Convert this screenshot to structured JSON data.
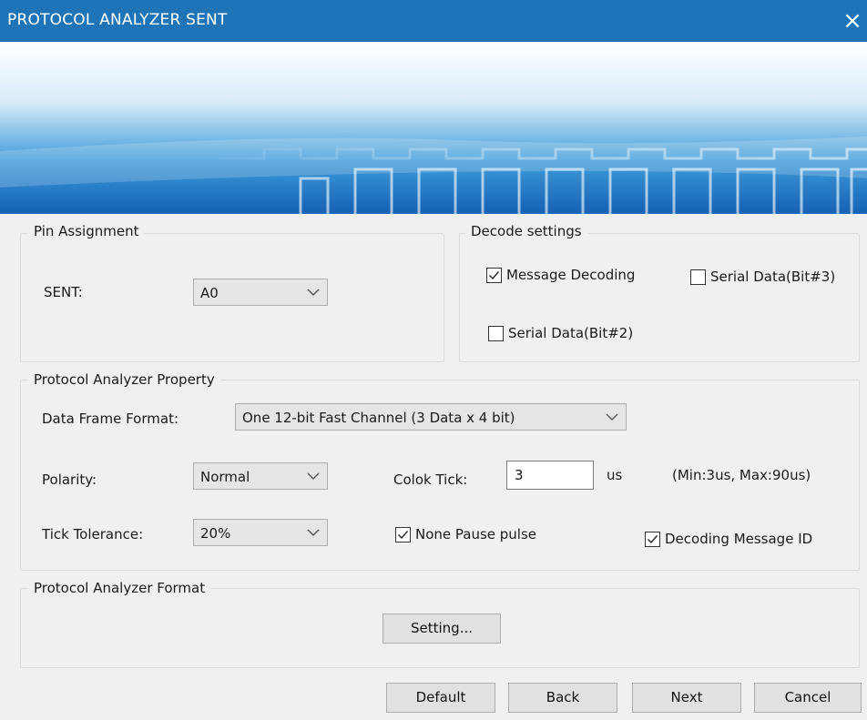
{
  "window": {
    "title": "PROTOCOL ANALYZER SENT",
    "close_glyph": "×",
    "titlebar_color": "#1e74b6"
  },
  "pin_assignment": {
    "title": "Pin Assignment",
    "sent_label": "SENT:",
    "sent_value": "A0"
  },
  "decode_settings": {
    "title": "Decode settings",
    "message_decoding": {
      "label": "Message Decoding",
      "checked": true
    },
    "serial_bit3": {
      "label": "Serial Data(Bit#3)",
      "checked": false
    },
    "serial_bit2": {
      "label": "Serial Data(Bit#2)",
      "checked": false
    }
  },
  "property": {
    "title": "Protocol Analyzer Property",
    "frame_format_label": "Data Frame Format:",
    "frame_format_value": "One 12-bit Fast Channel (3 Data x 4 bit)",
    "polarity_label": "Polarity:",
    "polarity_value": "Normal",
    "clock_tick_label": "Colok Tick:",
    "clock_tick_value": "3",
    "clock_tick_unit": "us",
    "clock_tick_range": "(Min:3us, Max:90us)",
    "tick_tolerance_label": "Tick Tolerance:",
    "tick_tolerance_value": "20%",
    "none_pause_pulse": {
      "label": "None Pause pulse",
      "checked": true
    },
    "decoding_message_id": {
      "label": "Decoding Message ID",
      "checked": true
    }
  },
  "format": {
    "title": "Protocol Analyzer Format",
    "setting_button": "Setting..."
  },
  "footer": {
    "default_button": "Default",
    "back_button": "Back",
    "next_button": "Next",
    "cancel_button": "Cancel"
  }
}
